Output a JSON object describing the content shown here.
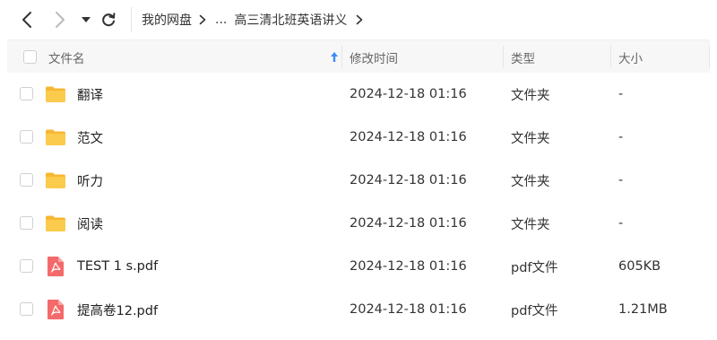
{
  "breadcrumb": {
    "items": [
      "我的网盘",
      "...",
      "高三清北班英语讲义"
    ]
  },
  "columns": {
    "name": "文件名",
    "modified": "修改时间",
    "type": "类型",
    "size": "大小"
  },
  "files": [
    {
      "name": "翻译",
      "modified": "2024-12-18 01:16",
      "type": "文件夹",
      "size": "-",
      "icon": "folder-icon"
    },
    {
      "name": "范文",
      "modified": "2024-12-18 01:16",
      "type": "文件夹",
      "size": "-",
      "icon": "folder-icon"
    },
    {
      "name": "听力",
      "modified": "2024-12-18 01:16",
      "type": "文件夹",
      "size": "-",
      "icon": "folder-icon"
    },
    {
      "name": "阅读",
      "modified": "2024-12-18 01:16",
      "type": "文件夹",
      "size": "-",
      "icon": "folder-icon"
    },
    {
      "name": "TEST 1 s.pdf",
      "modified": "2024-12-18 01:16",
      "type": "pdf文件",
      "size": "605KB",
      "icon": "pdf-icon"
    },
    {
      "name": "提高卷12.pdf",
      "modified": "2024-12-18 01:16",
      "type": "pdf文件",
      "size": "1.21MB",
      "icon": "pdf-icon"
    }
  ],
  "colors": {
    "folder": "#f9c84a",
    "pdf": "#f46a6a",
    "sort_arrow": "#3b8cf5"
  }
}
